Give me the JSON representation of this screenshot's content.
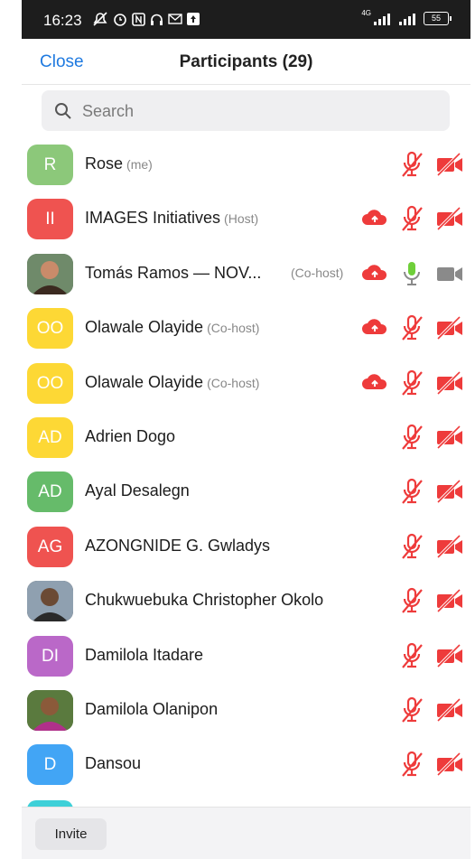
{
  "status_bar": {
    "time": "16:23",
    "network": "4G",
    "battery": "55"
  },
  "header": {
    "close_label": "Close",
    "title": "Participants (29)"
  },
  "search": {
    "placeholder": "Search"
  },
  "participants": [
    {
      "initials": "R",
      "name": "Rose",
      "role": "(me)",
      "avatar_color": "#8cc87a",
      "photo": false,
      "cloud": false,
      "mic": "muted",
      "video": "off"
    },
    {
      "initials": "II",
      "name": "IMAGES Initiatives",
      "role": "(Host)",
      "avatar_color": "#ef5350",
      "photo": false,
      "cloud": true,
      "mic": "muted",
      "video": "off"
    },
    {
      "initials": "",
      "name": "Tomás Ramos —  NOV...",
      "role": "(Co-host)",
      "avatar_color": "#556b5a",
      "photo": true,
      "cloud": true,
      "mic": "on",
      "video": "on"
    },
    {
      "initials": "OO",
      "name": "Olawale Olayide",
      "role": "(Co-host)",
      "avatar_color": "#fdd835",
      "photo": false,
      "cloud": true,
      "mic": "muted",
      "video": "off"
    },
    {
      "initials": "OO",
      "name": "Olawale Olayide",
      "role": "(Co-host)",
      "avatar_color": "#fdd835",
      "photo": false,
      "cloud": true,
      "mic": "muted",
      "video": "off"
    },
    {
      "initials": "AD",
      "name": "Adrien Dogo",
      "role": "",
      "avatar_color": "#fdd835",
      "photo": false,
      "cloud": false,
      "mic": "muted",
      "video": "off"
    },
    {
      "initials": "AD",
      "name": "Ayal Desalegn",
      "role": "",
      "avatar_color": "#66bb6a",
      "photo": false,
      "cloud": false,
      "mic": "muted",
      "video": "off"
    },
    {
      "initials": "AG",
      "name": "AZONGNIDE G. Gwladys",
      "role": "",
      "avatar_color": "#ef5350",
      "photo": false,
      "cloud": false,
      "mic": "muted",
      "video": "off"
    },
    {
      "initials": "",
      "name": "Chukwuebuka Christopher Okolo",
      "role": "",
      "avatar_color": "#3a3a3a",
      "photo": true,
      "cloud": false,
      "mic": "muted",
      "video": "off"
    },
    {
      "initials": "DI",
      "name": "Damilola Itadare",
      "role": "",
      "avatar_color": "#ba68c8",
      "photo": false,
      "cloud": false,
      "mic": "muted",
      "video": "off"
    },
    {
      "initials": "",
      "name": "Damilola Olanipon",
      "role": "",
      "avatar_color": "#4a6b3a",
      "photo": true,
      "cloud": false,
      "mic": "muted",
      "video": "off"
    },
    {
      "initials": "D",
      "name": "Dansou",
      "role": "",
      "avatar_color": "#42a5f5",
      "photo": false,
      "cloud": false,
      "mic": "muted",
      "video": "off"
    }
  ],
  "footer": {
    "invite_label": "Invite"
  },
  "colors": {
    "accent": "#1f7ae0",
    "muted_red": "#ee3b3b",
    "mic_on_green": "#6fcf3a",
    "video_on_gray": "#8a8a8a"
  }
}
